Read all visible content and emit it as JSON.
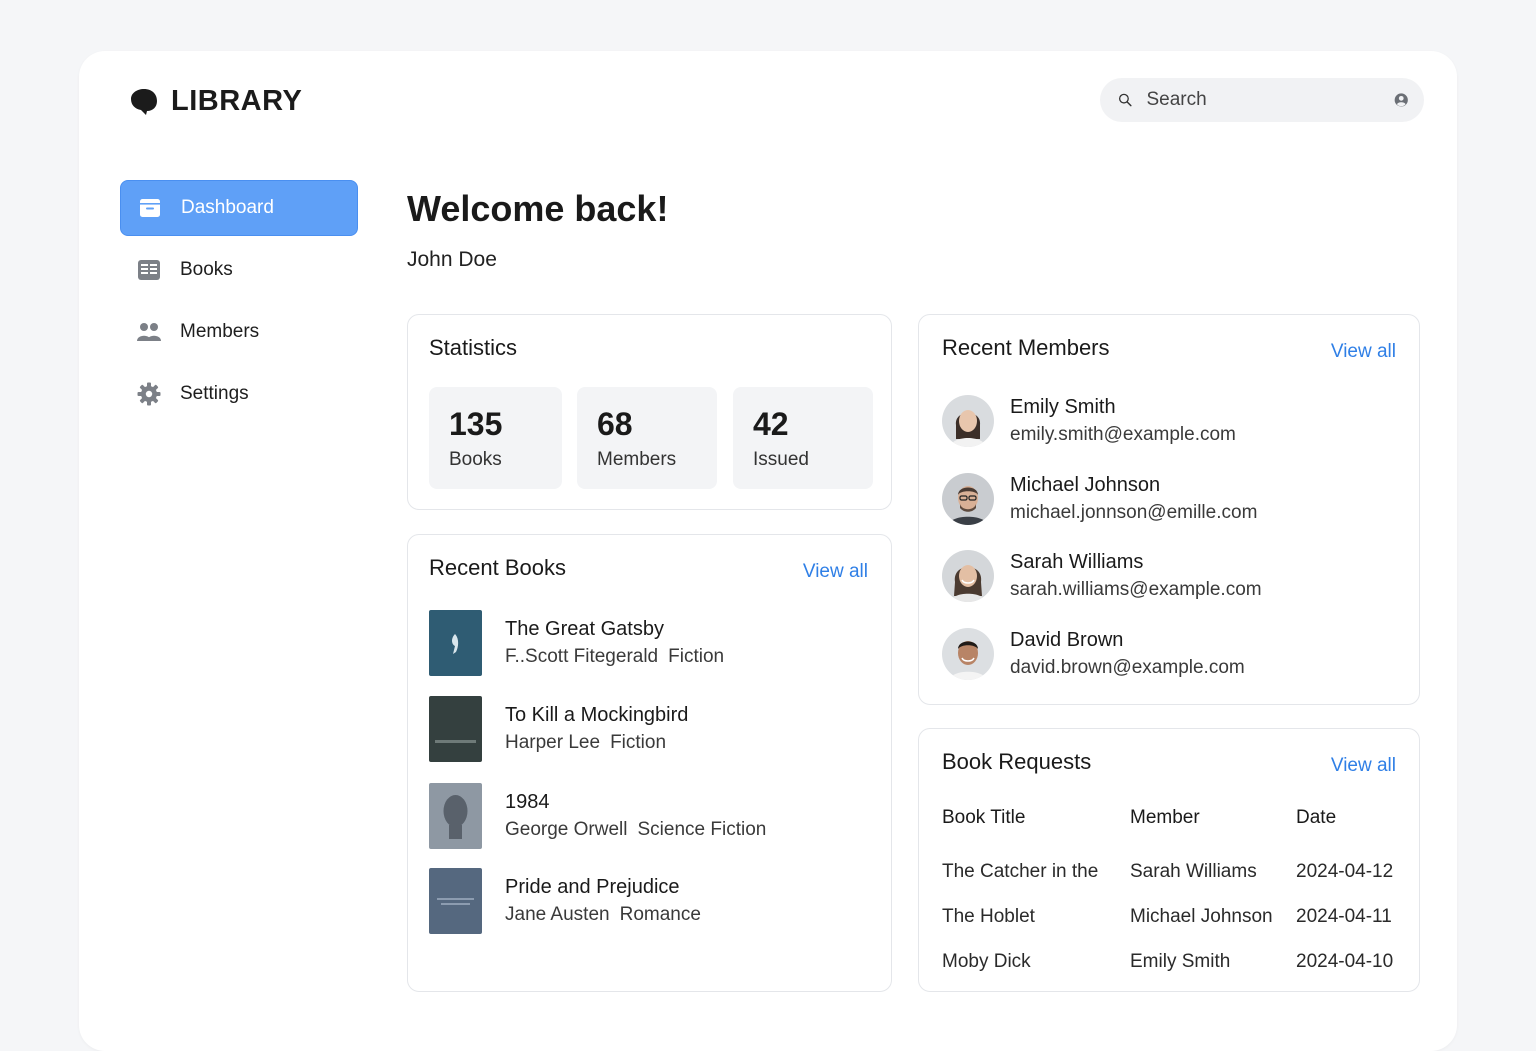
{
  "brand": {
    "name": "LIBRARY"
  },
  "search": {
    "placeholder": "Search"
  },
  "sidebar": {
    "items": [
      {
        "label": "Dashboard",
        "icon": "dashboard-icon",
        "active": true
      },
      {
        "label": "Books",
        "icon": "books-icon",
        "active": false
      },
      {
        "label": "Members",
        "icon": "members-icon",
        "active": false
      },
      {
        "label": "Settings",
        "icon": "gear-icon",
        "active": false
      }
    ]
  },
  "welcome": {
    "title": "Welcome back!",
    "user": "John Doe"
  },
  "statistics": {
    "title": "Statistics",
    "items": [
      {
        "value": "135",
        "label": "Books"
      },
      {
        "value": "68",
        "label": "Members"
      },
      {
        "value": "42",
        "label": "Issued"
      }
    ]
  },
  "recent_books": {
    "title": "Recent Books",
    "view_all": "View all",
    "items": [
      {
        "title": "The Great Gatsby",
        "author": "F..Scott Fitegerald",
        "genre": "Fiction",
        "cover_color": "#2f5c73"
      },
      {
        "title": "To Kill a Mockingbird",
        "author": "Harper Lee",
        "genre": "Fiction",
        "cover_color": "#34403f"
      },
      {
        "title": "1984",
        "author": "George Orwell",
        "genre": "Science Fiction",
        "cover_color": "#8e98a3"
      },
      {
        "title": "Pride and Prejudice",
        "author": "Jane Austen",
        "genre": "Romance",
        "cover_color": "#55687f"
      }
    ]
  },
  "recent_members": {
    "title": "Recent Members",
    "view_all": "View all",
    "items": [
      {
        "name": "Emily Smith",
        "email": "emily.smith@example.com"
      },
      {
        "name": "Michael Johnson",
        "email": "michael.jonnson@emille.com"
      },
      {
        "name": "Sarah Williams",
        "email": "sarah.williams@example.com"
      },
      {
        "name": "David Brown",
        "email": "david.brown@example.com"
      }
    ]
  },
  "book_requests": {
    "title": "Book Requests",
    "view_all": "View all",
    "columns": [
      "Book Title",
      "Member",
      "Date"
    ],
    "rows": [
      [
        "The Catcher in the",
        "Sarah Williams",
        "2024-04-12"
      ],
      [
        "The Hoblet",
        "Michael Johnson",
        "2024-04-11"
      ],
      [
        "Moby Dick",
        "Emily Smith",
        "2024-04-10"
      ]
    ]
  },
  "colors": {
    "accent": "#5fa0f7",
    "link": "#2f7fe6",
    "card_border": "#e4e6ea"
  }
}
